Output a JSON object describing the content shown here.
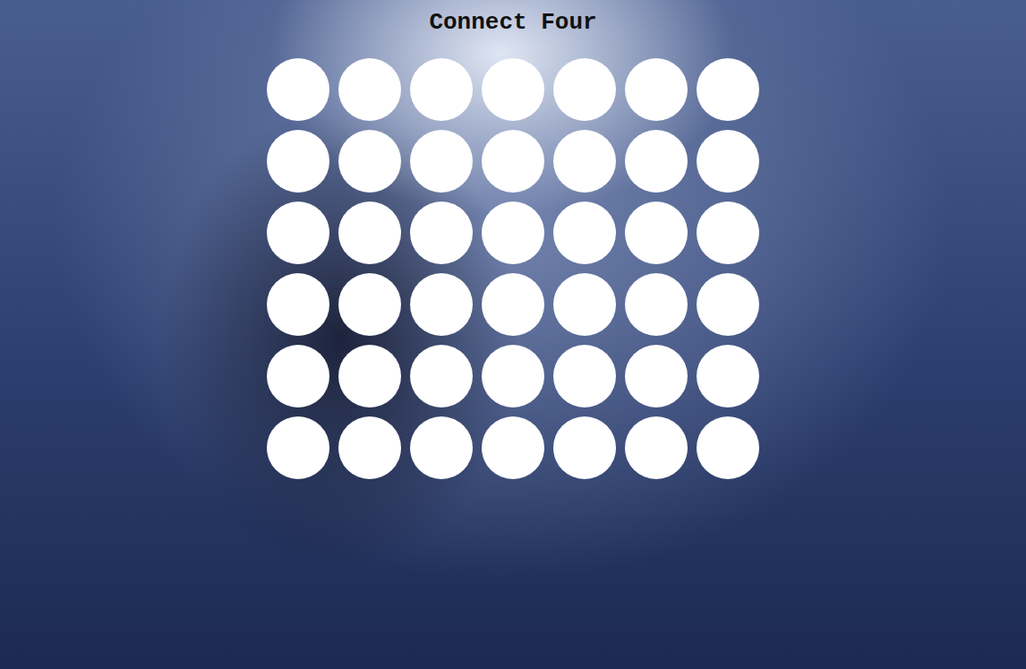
{
  "title": "Connect Four",
  "board": {
    "rows": [
      [
        {
          "disc": "empty"
        },
        {
          "disc": "empty"
        },
        {
          "disc": "empty"
        },
        {
          "disc": "empty"
        },
        {
          "disc": "empty"
        },
        {
          "disc": "empty"
        },
        {
          "disc": "empty"
        }
      ],
      [
        {
          "disc": "empty"
        },
        {
          "disc": "empty"
        },
        {
          "disc": "empty"
        },
        {
          "disc": "empty"
        },
        {
          "disc": "empty"
        },
        {
          "disc": "empty"
        },
        {
          "disc": "empty"
        }
      ],
      [
        {
          "disc": "empty"
        },
        {
          "disc": "empty"
        },
        {
          "disc": "empty"
        },
        {
          "disc": "empty"
        },
        {
          "disc": "empty"
        },
        {
          "disc": "empty"
        },
        {
          "disc": "empty"
        }
      ],
      [
        {
          "disc": "empty"
        },
        {
          "disc": "empty"
        },
        {
          "disc": "empty"
        },
        {
          "disc": "empty"
        },
        {
          "disc": "empty"
        },
        {
          "disc": "empty"
        },
        {
          "disc": "empty"
        }
      ],
      [
        {
          "disc": "empty"
        },
        {
          "disc": "empty"
        },
        {
          "disc": "empty"
        },
        {
          "disc": "empty"
        },
        {
          "disc": "empty"
        },
        {
          "disc": "empty"
        },
        {
          "disc": "empty"
        }
      ],
      [
        {
          "disc": "empty"
        },
        {
          "disc": "empty"
        },
        {
          "disc": "empty"
        },
        {
          "disc": "empty"
        },
        {
          "disc": "empty"
        },
        {
          "disc": "empty"
        },
        {
          "disc": "empty"
        }
      ]
    ]
  }
}
